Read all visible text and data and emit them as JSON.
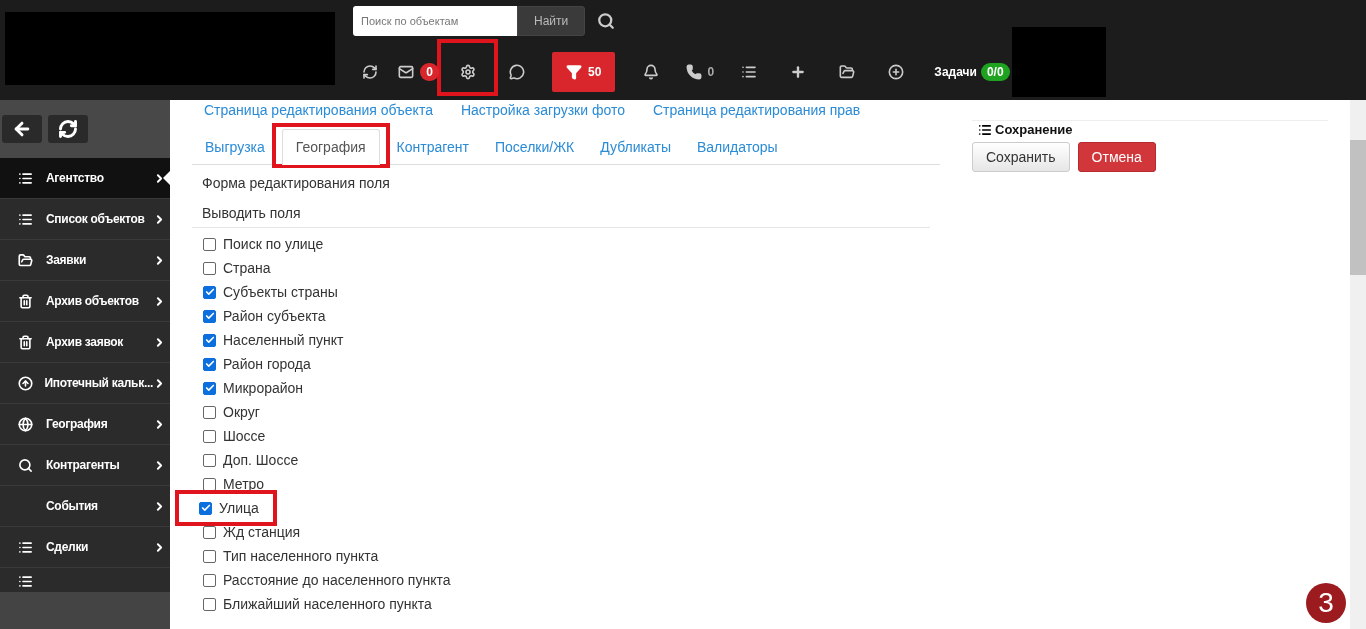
{
  "header": {
    "search": {
      "placeholder": "Поиск по объектам",
      "button": "Найти"
    },
    "toolbar": [
      {
        "kind": "refresh",
        "highlighted": false
      },
      {
        "kind": "mail",
        "badge": "0",
        "highlighted": false
      },
      {
        "kind": "settings",
        "highlighted": true
      },
      {
        "kind": "chat",
        "highlighted": false
      },
      {
        "kind": "filter",
        "count": "50",
        "highlighted": false
      },
      {
        "kind": "bell",
        "highlighted": false
      },
      {
        "kind": "phone",
        "count": "0",
        "highlighted": false
      },
      {
        "kind": "list",
        "highlighted": false
      },
      {
        "kind": "plus",
        "highlighted": false
      },
      {
        "kind": "folder",
        "highlighted": false
      },
      {
        "kind": "plus-circle",
        "highlighted": false
      }
    ],
    "tasks": {
      "label": "Задачи",
      "badge": "0/0"
    }
  },
  "sidebar": {
    "items": [
      {
        "label": "Агентство",
        "selected": true
      },
      {
        "label": "Список объектов",
        "selected": false
      },
      {
        "label": "Заявки",
        "selected": false
      },
      {
        "label": "Архив объектов",
        "selected": false
      },
      {
        "label": "Архив заявок",
        "selected": false
      },
      {
        "label": "Ипотечный кальк...",
        "selected": false
      },
      {
        "label": "География",
        "selected": false
      },
      {
        "label": "Контрагенты",
        "selected": false
      },
      {
        "label": "События",
        "selected": false
      },
      {
        "label": "Сделки",
        "selected": false
      }
    ],
    "overflow": true
  },
  "links": [
    "Страница редактирования объекта",
    "Настройка загрузки фото",
    "Страница редактирования прав"
  ],
  "tabs": [
    {
      "label": "Выгрузка",
      "selected": false,
      "highlighted": false
    },
    {
      "label": "География",
      "selected": true,
      "highlighted": true
    },
    {
      "label": "Контрагент",
      "selected": false,
      "highlighted": false
    },
    {
      "label": "Поселки/ЖК",
      "selected": false,
      "highlighted": false
    },
    {
      "label": "Дубликаты",
      "selected": false,
      "highlighted": false
    },
    {
      "label": "Валидаторы",
      "selected": false,
      "highlighted": false
    }
  ],
  "form": {
    "title": "Форма редактирования поля",
    "section": "Выводить поля",
    "fields": [
      {
        "label": "Поиск по улице",
        "checked": false,
        "highlighted": false
      },
      {
        "label": "Страна",
        "checked": false,
        "highlighted": false
      },
      {
        "label": "Субъекты страны",
        "checked": true,
        "highlighted": false
      },
      {
        "label": "Район субъекта",
        "checked": true,
        "highlighted": false
      },
      {
        "label": "Населенный пункт",
        "checked": true,
        "highlighted": false
      },
      {
        "label": "Район города",
        "checked": true,
        "highlighted": false
      },
      {
        "label": "Микрорайон",
        "checked": true,
        "highlighted": false
      },
      {
        "label": "Округ",
        "checked": false,
        "highlighted": false
      },
      {
        "label": "Шоссе",
        "checked": false,
        "highlighted": false
      },
      {
        "label": "Доп. Шоссе",
        "checked": false,
        "highlighted": false
      },
      {
        "label": "Метро",
        "checked": false,
        "highlighted": false
      },
      {
        "label": "Улица",
        "checked": true,
        "highlighted": true
      },
      {
        "label": "Жд станция",
        "checked": false,
        "highlighted": false
      },
      {
        "label": "Тип населенного пункта",
        "checked": false,
        "highlighted": false
      },
      {
        "label": "Расстояние до населенного пункта",
        "checked": false,
        "highlighted": false
      },
      {
        "label": "Ближайший населенного пункта",
        "checked": false,
        "highlighted": false
      }
    ]
  },
  "save_panel": {
    "title": "Сохранение",
    "buttons": [
      {
        "label": "Сохранить",
        "kind": "default"
      },
      {
        "label": "Отмена",
        "kind": "danger"
      }
    ]
  },
  "step_badge": "3"
}
